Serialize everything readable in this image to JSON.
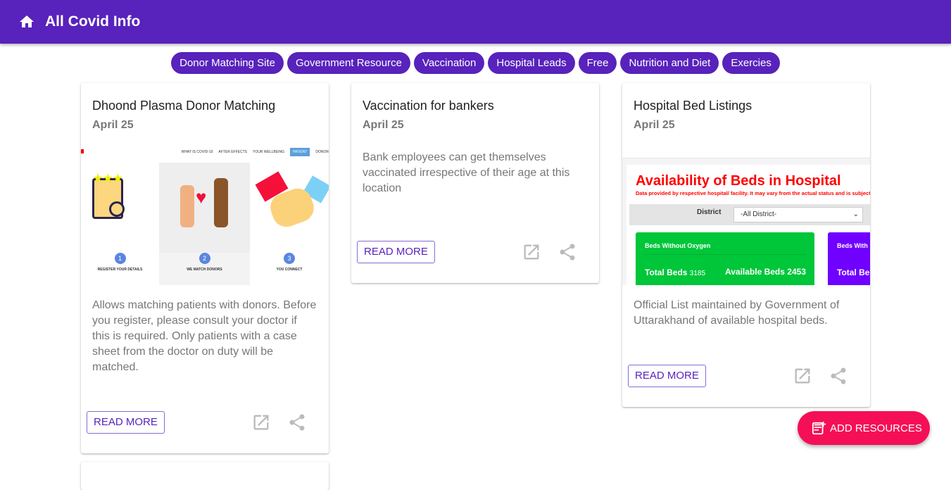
{
  "header": {
    "title": "All Covid Info",
    "home_icon": "home-icon"
  },
  "chips": [
    "Donor Matching Site",
    "Government Resource",
    "Vaccination",
    "Hospital Leads",
    "Free",
    "Nutrition and Diet",
    "Exercies"
  ],
  "cards": [
    {
      "title": "Dhoond Plasma Donor Matching",
      "date": "April 25",
      "description": "Allows matching patients with donors. Before you register, please consult your doctor if this is required. Only patients with a case sheet from the doctor on duty will be matched.",
      "read_more": "Read More",
      "preview": {
        "nav": [
          "WHAT IS COVID-19",
          "AFTER EFFECTS",
          "YOUR WELLBEING",
          "PATIENT",
          "DONOR"
        ],
        "steps": [
          {
            "n": "1",
            "label": "REGISTER YOUR DETAILS"
          },
          {
            "n": "2",
            "label": "WE MATCH DONORS"
          },
          {
            "n": "3",
            "label": "YOU CONNECT"
          }
        ]
      }
    },
    {
      "title": "Vaccination for bankers",
      "date": "April 25",
      "description": "Bank employees can get themselves vaccinated irrespective of their age at this location",
      "read_more": "Read More"
    },
    {
      "title": "Hospital Bed Listings",
      "date": "April 25",
      "description": "Official List maintained by Government of Uttarakhand of available hospital beds.",
      "read_more": "Read More",
      "preview": {
        "heading": "Availability of Beds in Hospital",
        "subheading": "Data provided by respective hospital/ facility. It may vary from the actual status and is subjected to",
        "district_label": "District",
        "district_value": "-All District-",
        "box1_title": "Beds Without Oxygen",
        "total_label": "Total Beds",
        "total_value": "3185",
        "available_label": "Available Beds",
        "available_value": "2453",
        "box2_title": "Beds With",
        "box2_total": "Total Be"
      }
    }
  ],
  "fab": {
    "label": "Add Resources"
  },
  "colors": {
    "primary": "#5822bc",
    "fab": "#f50f57",
    "green": "#00c63a",
    "purple": "#7000ff",
    "red": "#ff0000"
  }
}
